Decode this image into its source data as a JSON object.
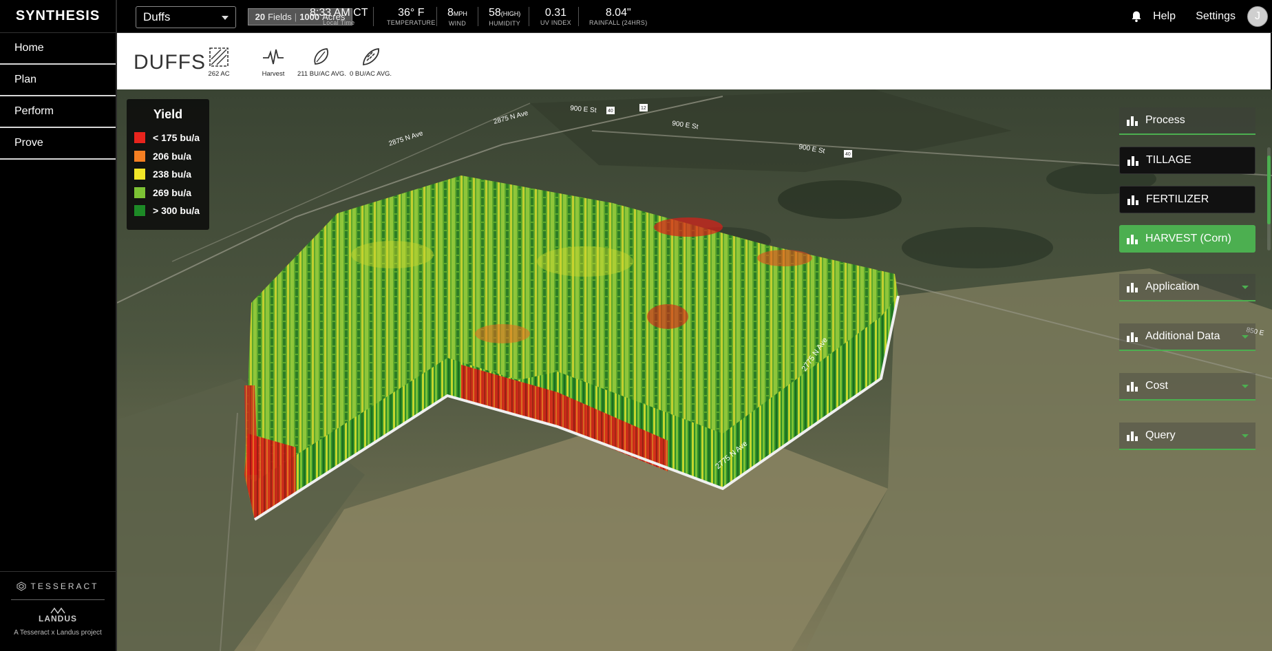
{
  "brand": "SYNTHESIS",
  "nav": [
    {
      "label": "Home"
    },
    {
      "label": "Plan"
    },
    {
      "label": "Perform"
    },
    {
      "label": "Prove"
    }
  ],
  "footer": {
    "tesseract": "TESSERACT",
    "landus": "LANDUS",
    "credit": "A Tesseract  x Landus  project"
  },
  "topbar": {
    "field_select": "Duffs",
    "fields_count": "20",
    "fields_label": "Fields",
    "acres_count": "1000",
    "acres_label": "Acres",
    "time": {
      "value": "8:33 AM CT",
      "label": "Local Time"
    },
    "temperature": {
      "value": "36° F",
      "label": "TEMPERATURE"
    },
    "wind": {
      "value": "8",
      "unit": "MPH",
      "label": "WIND"
    },
    "humidity": {
      "value": "58",
      "unit": "(HIGH)",
      "label": "HUMIDITY"
    },
    "uv": {
      "value": "0.31",
      "label": "UV INDEX"
    },
    "rainfall": {
      "value": "8.04\"",
      "label": "RAINFALL (24HRS)"
    },
    "help": "Help",
    "settings": "Settings",
    "avatar_initial": "J"
  },
  "header": {
    "title": "DUFFS",
    "stats": [
      {
        "icon": "acreage-icon",
        "label": "262 AC"
      },
      {
        "icon": "harvest-pulse-icon",
        "label": "Harvest"
      },
      {
        "icon": "seed-icon",
        "label": "211 BU/AC AVG."
      },
      {
        "icon": "corn-icon",
        "label": "0 BU/AC AVG."
      }
    ]
  },
  "legend": {
    "title": "Yield",
    "items": [
      {
        "label": "< 175 bu/a",
        "color": "#e8241d"
      },
      {
        "label": "206 bu/a",
        "color": "#f57f22"
      },
      {
        "label": "238 bu/a",
        "color": "#f2e628"
      },
      {
        "label": "269 bu/a",
        "color": "#7cc234"
      },
      {
        "label": "> 300 bu/a",
        "color": "#1d8a26"
      }
    ]
  },
  "panel": {
    "items": [
      {
        "label": "Process",
        "style": "trans"
      },
      {
        "label": "TILLAGE",
        "style": "dark"
      },
      {
        "label": "FERTILIZER",
        "style": "dark"
      },
      {
        "label": "HARVEST (Corn)",
        "style": "green"
      },
      {
        "label": "Application",
        "style": "trans"
      },
      {
        "label": "Additional Data",
        "style": "trans"
      },
      {
        "label": "Cost",
        "style": "trans"
      },
      {
        "label": "Query",
        "style": "trans"
      }
    ]
  },
  "map_labels": {
    "road1": "2875 N Ave",
    "road2": "900 E St",
    "road3": "900 E St",
    "road4": "900 E St",
    "road5": "2875 N Ave",
    "road6": "2775 N Ave",
    "road7": "2775 N Ave",
    "road8": "850 E",
    "shield1": "40",
    "shield2": "12",
    "shield3": "40"
  },
  "colors": {
    "accent": "#4caf50",
    "red": "#e8241d",
    "orange": "#f57f22",
    "yellow": "#f2e628",
    "lightgreen": "#7cc234",
    "green": "#1d8a26"
  }
}
